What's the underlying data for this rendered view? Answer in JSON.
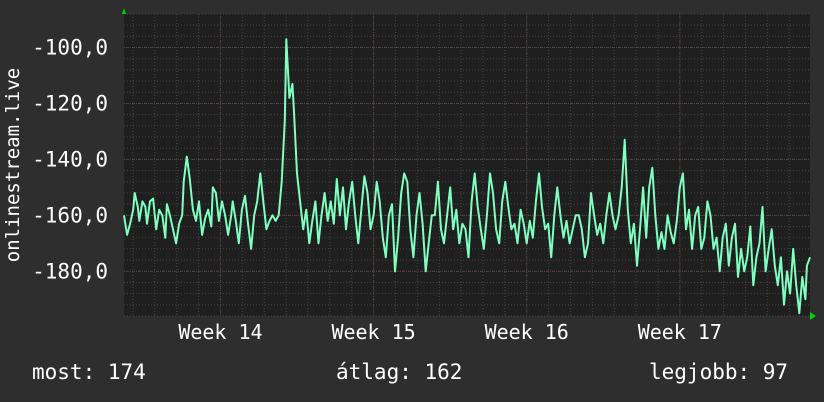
{
  "chart_data": {
    "type": "line",
    "ylabel": "onlinestream.live",
    "ylim": [
      -196,
      -88
    ],
    "yticks": [
      -100,
      -120,
      -140,
      -160,
      -180
    ],
    "ytick_labels": [
      "-100,0",
      "-120,0",
      "-140,0",
      "-160,0",
      "-180,0"
    ],
    "xlim": [
      13.37,
      17.85
    ],
    "xticks": [
      14,
      15,
      16,
      17
    ],
    "xtick_labels": [
      "Week 14",
      "Week 15",
      "Week 16",
      "Week 17"
    ],
    "grid": true,
    "colors": {
      "background": "#2e2e2e",
      "plot_area": "#1f1f1f",
      "grid": "#454545",
      "line": "#7fffc0",
      "arrow": "#00d000",
      "text": "#ffffff"
    },
    "series": [
      {
        "keypoints": [
          [
            13.37,
            -160
          ],
          [
            13.39,
            -167
          ],
          [
            13.41,
            -163
          ],
          [
            13.43,
            -158
          ],
          [
            13.44,
            -152
          ],
          [
            13.46,
            -157
          ],
          [
            13.47,
            -162
          ],
          [
            13.49,
            -155
          ],
          [
            13.51,
            -157
          ],
          [
            13.52,
            -163
          ],
          [
            13.54,
            -155
          ],
          [
            13.56,
            -154
          ],
          [
            13.58,
            -165
          ],
          [
            13.6,
            -158
          ],
          [
            13.62,
            -160
          ],
          [
            13.64,
            -168
          ],
          [
            13.65,
            -156
          ],
          [
            13.67,
            -160
          ],
          [
            13.69,
            -165
          ],
          [
            13.71,
            -170
          ],
          [
            13.73,
            -163
          ],
          [
            13.75,
            -160
          ],
          [
            13.76,
            -148
          ],
          [
            13.78,
            -139
          ],
          [
            13.8,
            -147
          ],
          [
            13.82,
            -158
          ],
          [
            13.84,
            -162
          ],
          [
            13.86,
            -155
          ],
          [
            13.88,
            -167
          ],
          [
            13.9,
            -161
          ],
          [
            13.92,
            -158
          ],
          [
            13.94,
            -164
          ],
          [
            13.95,
            -150
          ],
          [
            13.97,
            -152
          ],
          [
            13.99,
            -162
          ],
          [
            14.01,
            -155
          ],
          [
            14.03,
            -160
          ],
          [
            14.05,
            -167
          ],
          [
            14.07,
            -160
          ],
          [
            14.08,
            -155
          ],
          [
            14.1,
            -162
          ],
          [
            14.12,
            -170
          ],
          [
            14.14,
            -158
          ],
          [
            14.16,
            -153
          ],
          [
            14.18,
            -163
          ],
          [
            14.2,
            -172
          ],
          [
            14.22,
            -160
          ],
          [
            14.24,
            -155
          ],
          [
            14.26,
            -145
          ],
          [
            14.28,
            -155
          ],
          [
            14.3,
            -165
          ],
          [
            14.32,
            -162
          ],
          [
            14.34,
            -160
          ],
          [
            14.36,
            -162
          ],
          [
            14.38,
            -160
          ],
          [
            14.4,
            -148
          ],
          [
            14.42,
            -126
          ],
          [
            14.43,
            -97
          ],
          [
            14.45,
            -118
          ],
          [
            14.47,
            -113
          ],
          [
            14.48,
            -123
          ],
          [
            14.5,
            -145
          ],
          [
            14.52,
            -155
          ],
          [
            14.54,
            -165
          ],
          [
            14.56,
            -158
          ],
          [
            14.58,
            -170
          ],
          [
            14.6,
            -162
          ],
          [
            14.62,
            -155
          ],
          [
            14.64,
            -170
          ],
          [
            14.66,
            -160
          ],
          [
            14.68,
            -152
          ],
          [
            14.7,
            -162
          ],
          [
            14.72,
            -155
          ],
          [
            14.74,
            -163
          ],
          [
            14.76,
            -147
          ],
          [
            14.78,
            -160
          ],
          [
            14.8,
            -150
          ],
          [
            14.82,
            -165
          ],
          [
            14.84,
            -155
          ],
          [
            14.86,
            -148
          ],
          [
            14.88,
            -160
          ],
          [
            14.9,
            -170
          ],
          [
            14.92,
            -158
          ],
          [
            14.94,
            -146
          ],
          [
            14.96,
            -152
          ],
          [
            14.98,
            -165
          ],
          [
            15.0,
            -160
          ],
          [
            15.02,
            -148
          ],
          [
            15.04,
            -155
          ],
          [
            15.06,
            -168
          ],
          [
            15.08,
            -175
          ],
          [
            15.1,
            -160
          ],
          [
            15.12,
            -156
          ],
          [
            15.14,
            -180
          ],
          [
            15.16,
            -168
          ],
          [
            15.18,
            -152
          ],
          [
            15.2,
            -145
          ],
          [
            15.22,
            -148
          ],
          [
            15.24,
            -165
          ],
          [
            15.26,
            -175
          ],
          [
            15.28,
            -160
          ],
          [
            15.3,
            -152
          ],
          [
            15.32,
            -163
          ],
          [
            15.34,
            -180
          ],
          [
            15.36,
            -170
          ],
          [
            15.38,
            -160
          ],
          [
            15.4,
            -160
          ],
          [
            15.42,
            -148
          ],
          [
            15.44,
            -165
          ],
          [
            15.46,
            -170
          ],
          [
            15.48,
            -160
          ],
          [
            15.5,
            -150
          ],
          [
            15.52,
            -165
          ],
          [
            15.54,
            -158
          ],
          [
            15.56,
            -170
          ],
          [
            15.58,
            -163
          ],
          [
            15.6,
            -165
          ],
          [
            15.62,
            -175
          ],
          [
            15.64,
            -155
          ],
          [
            15.66,
            -145
          ],
          [
            15.68,
            -157
          ],
          [
            15.7,
            -165
          ],
          [
            15.72,
            -172
          ],
          [
            15.74,
            -160
          ],
          [
            15.76,
            -145
          ],
          [
            15.78,
            -152
          ],
          [
            15.8,
            -165
          ],
          [
            15.82,
            -170
          ],
          [
            15.84,
            -155
          ],
          [
            15.86,
            -148
          ],
          [
            15.88,
            -157
          ],
          [
            15.9,
            -165
          ],
          [
            15.92,
            -163
          ],
          [
            15.94,
            -170
          ],
          [
            15.96,
            -158
          ],
          [
            15.98,
            -163
          ],
          [
            16.0,
            -170
          ],
          [
            16.02,
            -162
          ],
          [
            16.04,
            -168
          ],
          [
            16.06,
            -155
          ],
          [
            16.08,
            -145
          ],
          [
            16.1,
            -157
          ],
          [
            16.12,
            -165
          ],
          [
            16.14,
            -163
          ],
          [
            16.16,
            -175
          ],
          [
            16.18,
            -160
          ],
          [
            16.2,
            -150
          ],
          [
            16.22,
            -160
          ],
          [
            16.24,
            -168
          ],
          [
            16.26,
            -162
          ],
          [
            16.28,
            -170
          ],
          [
            16.3,
            -165
          ],
          [
            16.32,
            -160
          ],
          [
            16.34,
            -160
          ],
          [
            16.36,
            -165
          ],
          [
            16.38,
            -175
          ],
          [
            16.4,
            -170
          ],
          [
            16.42,
            -152
          ],
          [
            16.44,
            -160
          ],
          [
            16.46,
            -167
          ],
          [
            16.48,
            -163
          ],
          [
            16.5,
            -170
          ],
          [
            16.52,
            -160
          ],
          [
            16.54,
            -152
          ],
          [
            16.56,
            -160
          ],
          [
            16.58,
            -165
          ],
          [
            16.6,
            -160
          ],
          [
            16.62,
            -150
          ],
          [
            16.64,
            -133
          ],
          [
            16.66,
            -158
          ],
          [
            16.68,
            -170
          ],
          [
            16.7,
            -163
          ],
          [
            16.72,
            -178
          ],
          [
            16.74,
            -165
          ],
          [
            16.76,
            -150
          ],
          [
            16.78,
            -168
          ],
          [
            16.8,
            -150
          ],
          [
            16.82,
            -143
          ],
          [
            16.84,
            -160
          ],
          [
            16.86,
            -172
          ],
          [
            16.88,
            -166
          ],
          [
            16.9,
            -172
          ],
          [
            16.92,
            -160
          ],
          [
            16.94,
            -166
          ],
          [
            16.96,
            -170
          ],
          [
            16.98,
            -162
          ],
          [
            17.0,
            -150
          ],
          [
            17.02,
            -145
          ],
          [
            17.04,
            -165
          ],
          [
            17.06,
            -158
          ],
          [
            17.08,
            -172
          ],
          [
            17.1,
            -160
          ],
          [
            17.12,
            -157
          ],
          [
            17.14,
            -172
          ],
          [
            17.16,
            -168
          ],
          [
            17.18,
            -155
          ],
          [
            17.2,
            -160
          ],
          [
            17.22,
            -172
          ],
          [
            17.24,
            -168
          ],
          [
            17.26,
            -180
          ],
          [
            17.28,
            -168
          ],
          [
            17.3,
            -163
          ],
          [
            17.32,
            -178
          ],
          [
            17.34,
            -168
          ],
          [
            17.36,
            -163
          ],
          [
            17.38,
            -182
          ],
          [
            17.4,
            -172
          ],
          [
            17.42,
            -180
          ],
          [
            17.44,
            -175
          ],
          [
            17.46,
            -164
          ],
          [
            17.48,
            -185
          ],
          [
            17.5,
            -175
          ],
          [
            17.52,
            -170
          ],
          [
            17.54,
            -157
          ],
          [
            17.56,
            -180
          ],
          [
            17.58,
            -172
          ],
          [
            17.6,
            -165
          ],
          [
            17.62,
            -178
          ],
          [
            17.64,
            -185
          ],
          [
            17.66,
            -175
          ],
          [
            17.68,
            -192
          ],
          [
            17.7,
            -180
          ],
          [
            17.72,
            -188
          ],
          [
            17.74,
            -172
          ],
          [
            17.76,
            -185
          ],
          [
            17.78,
            -195
          ],
          [
            17.8,
            -182
          ],
          [
            17.82,
            -190
          ],
          [
            17.83,
            -178
          ],
          [
            17.85,
            -175
          ]
        ]
      }
    ]
  },
  "footer": {
    "current": "most: 174",
    "average": "átlag: 162",
    "best": "legjobb: 97"
  }
}
